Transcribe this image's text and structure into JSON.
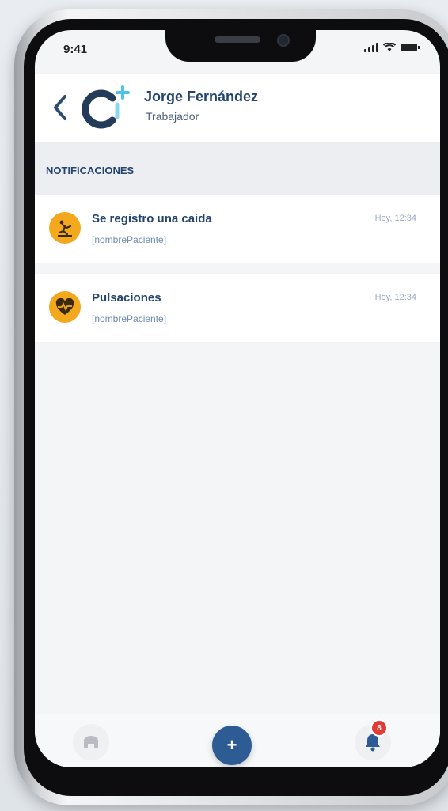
{
  "status_bar": {
    "time": "9:41"
  },
  "header": {
    "user_name": "Jorge Fernández",
    "user_role": "Trabajador"
  },
  "section": {
    "title": "NOTIFICACIONES"
  },
  "notifications": [
    {
      "title": "Se registro una caida",
      "subtitle": "[nombrePaciente]",
      "time": "Hoy, 12:34",
      "icon": "fall-icon"
    },
    {
      "title": "Pulsaciones",
      "subtitle": "[nombrePaciente]",
      "time": "Hoy, 12:34",
      "icon": "heart-pulse-icon"
    }
  ],
  "bottom_nav": {
    "home_icon": "home-icon",
    "add_label": "+",
    "bell_badge": "8"
  },
  "colors": {
    "accent": "#2d5b94",
    "title": "#23446f",
    "warning": "#f4a81d",
    "badge": "#e53935"
  }
}
